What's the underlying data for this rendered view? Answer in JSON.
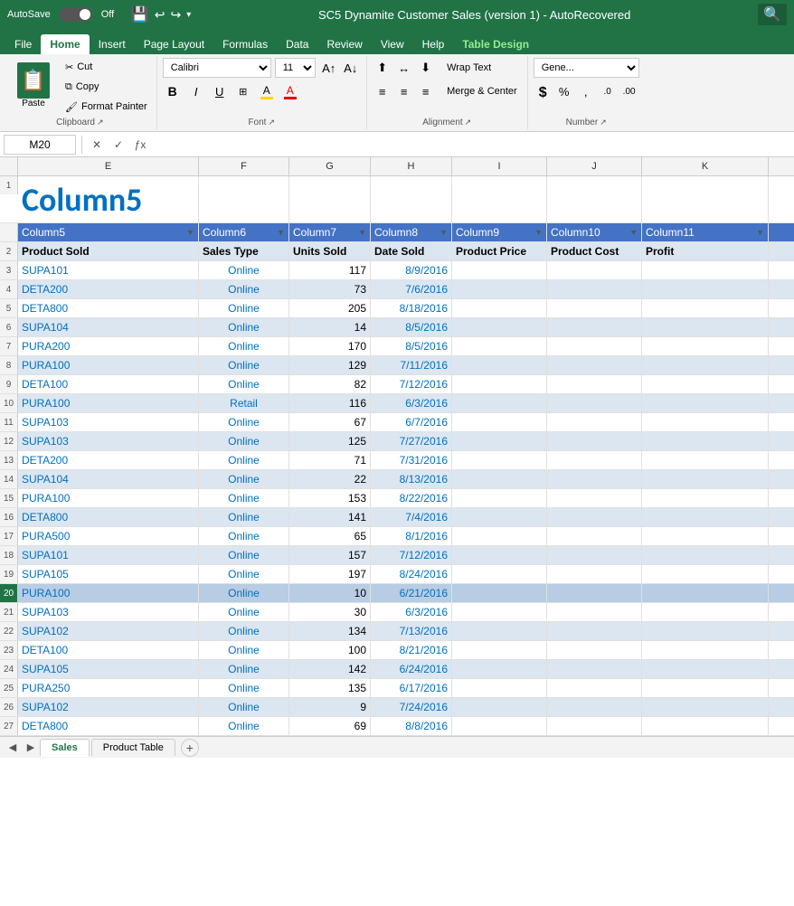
{
  "titlebar": {
    "autosave_label": "AutoSave",
    "autosave_state": "Off",
    "title": "SC5 Dynamite Customer Sales (version 1)  -  AutoRecovered",
    "search_placeholder": "🔍"
  },
  "ribbon": {
    "tabs": [
      "File",
      "Home",
      "Insert",
      "Page Layout",
      "Formulas",
      "Data",
      "Review",
      "View",
      "Help",
      "Table Design"
    ],
    "active_tab": "Home",
    "clipboard": {
      "paste_label": "Paste",
      "cut_label": "Cut",
      "copy_label": "Copy",
      "format_painter_label": "Format Painter",
      "group_label": "Clipboard"
    },
    "font": {
      "font_name": "Calibri",
      "font_size": "11",
      "bold_label": "B",
      "italic_label": "I",
      "underline_label": "U",
      "group_label": "Font"
    },
    "alignment": {
      "wrap_text_label": "Wrap Text",
      "merge_center_label": "Merge & Center",
      "group_label": "Alignment"
    },
    "number": {
      "general_label": "Gene...",
      "dollar_label": "$",
      "group_label": "Number"
    }
  },
  "formula_bar": {
    "cell_ref": "M20",
    "formula": ""
  },
  "spreadsheet": {
    "col_header_row": [
      "E",
      "F",
      "G",
      "H",
      "I",
      "J",
      "K"
    ],
    "row1": {
      "col5_text": "Column5",
      "col6": "",
      "col7": "",
      "col8": "",
      "col9": "",
      "col10": "",
      "col11": ""
    },
    "filter_row": {
      "col5": "Column5",
      "col6": "Column6",
      "col7": "Column7",
      "col8": "Column8",
      "col9": "Column9",
      "col10": "Column10",
      "col11": "Column11"
    },
    "header_row": {
      "col5": "Product Sold",
      "col6": "Sales Type",
      "col7": "Units Sold",
      "col8": "Date Sold",
      "col9": "Product Price",
      "col10": "Product Cost",
      "col11": "Profit"
    },
    "data_rows": [
      {
        "num": 3,
        "col5": "SUPA101",
        "col6": "Online",
        "col7": "117",
        "col8": "8/9/2016"
      },
      {
        "num": 4,
        "col5": "DETA200",
        "col6": "Online",
        "col7": "73",
        "col8": "7/6/2016"
      },
      {
        "num": 5,
        "col5": "DETA800",
        "col6": "Online",
        "col7": "205",
        "col8": "8/18/2016"
      },
      {
        "num": 6,
        "col5": "SUPA104",
        "col6": "Online",
        "col7": "14",
        "col8": "8/5/2016"
      },
      {
        "num": 7,
        "col5": "PURA200",
        "col6": "Online",
        "col7": "170",
        "col8": "8/5/2016"
      },
      {
        "num": 8,
        "col5": "PURA100",
        "col6": "Online",
        "col7": "129",
        "col8": "7/11/2016"
      },
      {
        "num": 9,
        "col5": "DETA100",
        "col6": "Online",
        "col7": "82",
        "col8": "7/12/2016"
      },
      {
        "num": 10,
        "col5": "PURA100",
        "col6": "Retail",
        "col7": "116",
        "col8": "6/3/2016"
      },
      {
        "num": 11,
        "col5": "SUPA103",
        "col6": "Online",
        "col7": "67",
        "col8": "6/7/2016"
      },
      {
        "num": 12,
        "col5": "SUPA103",
        "col6": "Online",
        "col7": "125",
        "col8": "7/27/2016"
      },
      {
        "num": 13,
        "col5": "DETA200",
        "col6": "Online",
        "col7": "71",
        "col8": "7/31/2016"
      },
      {
        "num": 14,
        "col5": "SUPA104",
        "col6": "Online",
        "col7": "22",
        "col8": "8/13/2016"
      },
      {
        "num": 15,
        "col5": "PURA100",
        "col6": "Online",
        "col7": "153",
        "col8": "8/22/2016"
      },
      {
        "num": 16,
        "col5": "DETA800",
        "col6": "Online",
        "col7": "141",
        "col8": "7/4/2016"
      },
      {
        "num": 17,
        "col5": "PURA500",
        "col6": "Online",
        "col7": "65",
        "col8": "8/1/2016"
      },
      {
        "num": 18,
        "col5": "SUPA101",
        "col6": "Online",
        "col7": "157",
        "col8": "7/12/2016"
      },
      {
        "num": 19,
        "col5": "SUPA105",
        "col6": "Online",
        "col7": "197",
        "col8": "8/24/2016"
      },
      {
        "num": 20,
        "col5": "PURA100",
        "col6": "Online",
        "col7": "10",
        "col8": "6/21/2016",
        "selected": true
      },
      {
        "num": 21,
        "col5": "SUPA103",
        "col6": "Online",
        "col7": "30",
        "col8": "6/3/2016"
      },
      {
        "num": 22,
        "col5": "SUPA102",
        "col6": "Online",
        "col7": "134",
        "col8": "7/13/2016"
      },
      {
        "num": 23,
        "col5": "DETA100",
        "col6": "Online",
        "col7": "100",
        "col8": "8/21/2016"
      },
      {
        "num": 24,
        "col5": "SUPA105",
        "col6": "Online",
        "col7": "142",
        "col8": "6/24/2016"
      },
      {
        "num": 25,
        "col5": "PURA250",
        "col6": "Online",
        "col7": "135",
        "col8": "6/17/2016"
      },
      {
        "num": 26,
        "col5": "SUPA102",
        "col6": "Online",
        "col7": "9",
        "col8": "7/24/2016"
      },
      {
        "num": 27,
        "col5": "DETA800",
        "col6": "Online",
        "col7": "69",
        "col8": "8/8/2016"
      }
    ]
  },
  "sheet_tabs": {
    "tabs": [
      "Sales",
      "Product Table"
    ],
    "active_tab": "Sales",
    "add_label": "+"
  }
}
